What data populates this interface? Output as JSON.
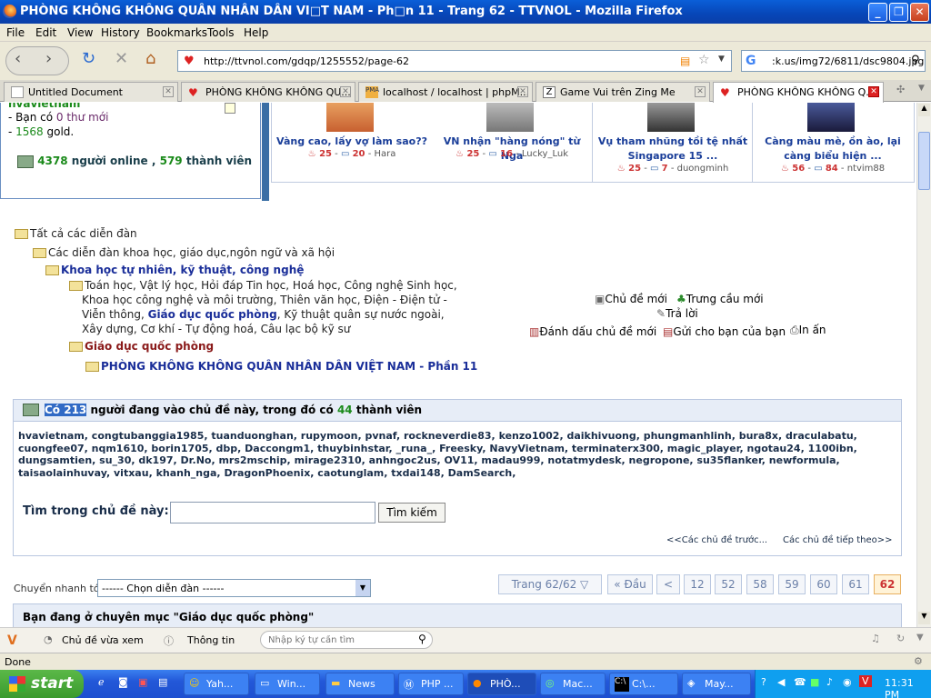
{
  "window": {
    "title": "PHÒNG KHÔNG KHÔNG QUÂN NHÂN DÂN VI□T NAM - Ph□n 11 - Trang 62 - TTVNOL - Mozilla Firefox"
  },
  "menu": [
    "File",
    "Edit",
    "View",
    "History",
    "Bookmarks",
    "Tools",
    "Help"
  ],
  "nav": {
    "url": "http://ttvnol.com/gdqp/1255552/page-62",
    "search": ":k.us/img72/6811/dsc9804.jpg"
  },
  "tabs": [
    {
      "label": "Untitled Document"
    },
    {
      "label": "PHÒNG KHÔNG KHÔNG QU..."
    },
    {
      "label": "localhost / localhost | phpM..."
    },
    {
      "label": "Game Vui trên Zing Me"
    },
    {
      "label": "PHÒNG KHÔNG KHÔNG Q..."
    }
  ],
  "user": {
    "name": "hvavietnam",
    "msg_prefix": "- Bạn có ",
    "msg_count": "0 thư mới",
    "gold_prefix": "- ",
    "gold": "1568",
    "gold_suffix": " gold.",
    "online_count": "4378",
    "online_label": " người online , ",
    "members": "579",
    "members_label": " thành viên"
  },
  "news": [
    {
      "title": "Vàng cao, lấy vợ làm sao??",
      "likes": "25",
      "comments": "20",
      "author": "Hara"
    },
    {
      "title": "VN nhận \"hàng nóng\" từ Nga",
      "likes": "25",
      "comments": "16",
      "author": "Lucky_Luk"
    },
    {
      "title": "Vụ tham nhũng tồi tệ nhất Singapore 15 ...",
      "likes": "25",
      "comments": "7",
      "author": "duongminh"
    },
    {
      "title": "Càng màu mè, ồn ào, lại càng biểu hiện ...",
      "likes": "56",
      "comments": "84",
      "author": "ntvim88"
    }
  ],
  "tree": {
    "root": "Tất cả các diễn đàn",
    "l1": "Các diễn đàn khoa học, giáo dục,ngôn ngữ và xã hội",
    "l2": "Khoa học tự nhiên, kỹ thuật, công nghệ",
    "l3a": "Toán học, Vật lý học, Hỏi đáp Tin học, Hoá học, Công nghệ Sinh học,",
    "l3b": "Khoa học công nghệ và môi trường, Thiên văn học, Điện - Điện tử -",
    "l3c_pre": "Viễn thông, ",
    "l3c_bold": "Giáo dục quốc phòng",
    "l3c_post": ", Kỹ thuật quân sự nước ngoài,",
    "l3d": "Xây dựng, Cơ khí - Tự động hoá, Câu lạc bộ kỹ sư",
    "l4": "Giáo dục quốc phòng",
    "l5": "PHÒNG KHÔNG KHÔNG QUÂN NHÂN DÂN VIỆT NAM - Phần 11"
  },
  "actions": {
    "new_topic": "Chủ đề mới",
    "poll": "Trưng cầu mới",
    "reply": "Trả lời",
    "mark": "Đánh dấu chủ đề mới",
    "send": "Gửi cho bạn của bạn",
    "print": "In ấn"
  },
  "online": {
    "pre": "Có 213",
    "mid": " người đang vào chủ đề này, trong đó có ",
    "members": "44",
    "post": " thành viên",
    "users": "hvavietnam, congtubanggia1985, tuanduonghan, rupymoon, pvnaf, rockneverdie83, kenzo1002, daikhivuong, phungmanhlinh, bura8x, draculabatu, cuongfee07, nqm1610, borin1705, dbp, Daccongm1, thuybinhstar, _runa_, Freesky, NavyVietnam, terminaterx300, magic_player, ngotau24, 1100ibn, dungsamtien, su_30, dk197, Dr.No, mrs2mschip, mirage2310, anhngoc2us, OV11, madau999, notatmydesk, negropone, su35flanker, newformula, taisaolainhuvay, vitxau, khanh_nga, DragonPhoenix, caotunglam, txdai148, DamSearch,",
    "search_label": "Tìm trong chủ đề này:",
    "search_btn": "Tìm kiếm",
    "prev": "<<Các chủ đề trước...",
    "next": "Các chủ đề tiếp theo>>"
  },
  "jump": {
    "label": "Chuyển nhanh tới:",
    "select": "------ Chọn diễn đàn ------"
  },
  "pager": {
    "info": "Trang 62/62",
    "first": "« Đầu",
    "prev": "<",
    "pages": [
      "12",
      "52",
      "58",
      "59",
      "60",
      "61",
      "62"
    ]
  },
  "breadcrumb": "Bạn đang ở chuyên mục \"Giáo dục quốc phòng\"",
  "bottombar": {
    "recent": "Chủ đề vừa xem",
    "info": "Thông tin",
    "placeholder": "Nhập ký tự cần tìm"
  },
  "status": "Done",
  "taskbar": {
    "start": "start",
    "items": [
      "Yah...",
      "Win...",
      "News",
      "PHP ...",
      "PHÒ...",
      "Mac...",
      "C:\\...",
      "May..."
    ],
    "clock": "11:31 PM"
  }
}
